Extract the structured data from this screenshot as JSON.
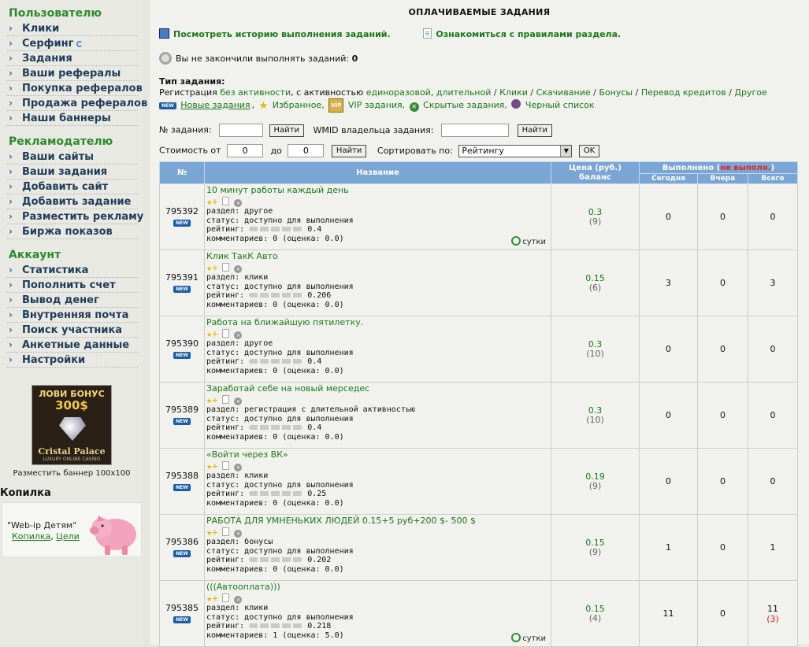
{
  "sidebar": {
    "user_title": "Пользователю",
    "user_items": [
      "Клики",
      "Серфинг",
      "Задания",
      "Ваши рефералы",
      "Покупка рефералов",
      "Продажа рефералов",
      "Наши баннеры"
    ],
    "adv_title": "Рекламодателю",
    "adv_items": [
      "Ваши сайты",
      "Ваши задания",
      "Добавить сайт",
      "Добавить задание",
      "Разместить рекламу",
      "Биржа показов"
    ],
    "acc_title": "Аккаунт",
    "acc_items": [
      "Статистика",
      "Пополнить счет",
      "Вывод денег",
      "Внутренняя почта",
      "Поиск участника",
      "Анкетные данные",
      "Настройки"
    ],
    "banner": {
      "line1": "ЛОВИ БОНУС",
      "line2": "300$",
      "line3": "Cristal Palace",
      "line4": "LUXURY ONLINE CASINO",
      "caption": "Разместить баннер 100x100"
    },
    "kopilka": {
      "title": "Копилка",
      "text": "\"Web-ip Детям\"",
      "link1": "Копилка",
      "comma": ",",
      "link2": "Цели"
    }
  },
  "main": {
    "title": "ОПЛАЧИВАЕМЫЕ ЗАДАНИЯ",
    "history_link": "Посмотреть историю выполнения заданий.",
    "rules_link": "Ознакомиться с правилами раздела.",
    "notfinished_label": "Вы не закончили выполнять заданий:",
    "notfinished_count": "0",
    "types": {
      "title": "Тип задания:",
      "reg": "Регистрация",
      "no_activity": "без активности",
      "with_activity": ", с активностью",
      "one_time": "единоразовой",
      "long": "длительной",
      "clicks": "Клики",
      "download": "Скачивание",
      "bonuses": "Бонусы",
      "credit": "Перевод кредитов",
      "other": "Другое",
      "new_badge": "NEW",
      "new_tasks": "Новые задания",
      "favorites": "Избранное,",
      "vip_badge": "VIP",
      "vip": "VIP задания,",
      "hidden": "Скрытые задания,",
      "blacklist": "Черный список"
    },
    "search": {
      "task_no_label": "№ задания:",
      "find": "Найти",
      "wmid_label": "WMID владельца задания:",
      "cost_from": "Стоимость от",
      "cost_from_val": "0",
      "to": "до",
      "to_val": "0",
      "sort_label": "Сортировать по:",
      "sort_value": "Рейтингу",
      "ok": "OK"
    },
    "table": {
      "h_num": "№",
      "h_name": "Название",
      "h_price": "Цена (руб.)",
      "h_balance": "баланс",
      "h_done": "Выполнено (",
      "h_notdone": "не выполн.",
      "h_done_close": ")",
      "h_today": "Сегодня",
      "h_yesterday": "Вчера",
      "h_total": "Всего",
      "new_badge": "NEW",
      "section_prefix": "раздел: ",
      "status_prefix": "статус: ",
      "rating_prefix": "рейтинг: ",
      "comments_prefix": "комментариев: ",
      "sutki": "сутки",
      "rows": [
        {
          "id": "795392",
          "name": "10 минут работы каждый день",
          "section": "другое",
          "status": "доступно для выполнения",
          "rating": "0.4",
          "comments": "0 (оценка: 0.0)",
          "price": "0.3",
          "balance": "(9)",
          "today": "0",
          "yesterday": "0",
          "total": "0",
          "total_red": "",
          "sutki": true
        },
        {
          "id": "795391",
          "name": "Клик ТакК Авто",
          "section": "клики",
          "status": "доступно для выполнения",
          "rating": "0.206",
          "comments": "0 (оценка: 0.0)",
          "price": "0.15",
          "balance": "(6)",
          "today": "3",
          "yesterday": "0",
          "total": "3",
          "total_red": "",
          "sutki": false
        },
        {
          "id": "795390",
          "name": "Работа на ближайшую пятилетку.",
          "section": "другое",
          "status": "доступно для выполнения",
          "rating": "0.4",
          "comments": "0 (оценка: 0.0)",
          "price": "0.3",
          "balance": "(10)",
          "today": "0",
          "yesterday": "0",
          "total": "0",
          "total_red": "",
          "sutki": false
        },
        {
          "id": "795389",
          "name": "Заработай себе на новый мерседес",
          "section": "регистрация с длительной активностью",
          "status": "доступно для выполнения",
          "rating": "0.4",
          "comments": "0 (оценка: 0.0)",
          "price": "0.3",
          "balance": "(10)",
          "today": "0",
          "yesterday": "0",
          "total": "0",
          "total_red": "",
          "sutki": false
        },
        {
          "id": "795388",
          "name": "«Войти через ВК»",
          "section": "клики",
          "status": "доступно для выполнения",
          "rating": "0.25",
          "comments": "0 (оценка: 0.0)",
          "price": "0.19",
          "balance": "(9)",
          "today": "0",
          "yesterday": "0",
          "total": "0",
          "total_red": "",
          "sutki": false
        },
        {
          "id": "795386",
          "name": "РАБОТА ДЛЯ УМНЕНЬКИХ ЛЮДЕЙ 0.15+5 руб+200 $- 500 $",
          "section": "бонусы",
          "status": "доступно для выполнения",
          "rating": "0.202",
          "comments": "0 (оценка: 0.0)",
          "price": "0.15",
          "balance": "(9)",
          "today": "1",
          "yesterday": "0",
          "total": "1",
          "total_red": "",
          "sutki": false
        },
        {
          "id": "795385",
          "name": "(((Автооплата)))",
          "section": "клики",
          "status": "доступно для выполнения",
          "rating": "0.218",
          "comments": "1 (оценка: 5.0)",
          "price": "0.15",
          "balance": "(4)",
          "today": "11",
          "yesterday": "0",
          "total": "11",
          "total_red": "(3)",
          "sutki": true
        }
      ]
    }
  }
}
